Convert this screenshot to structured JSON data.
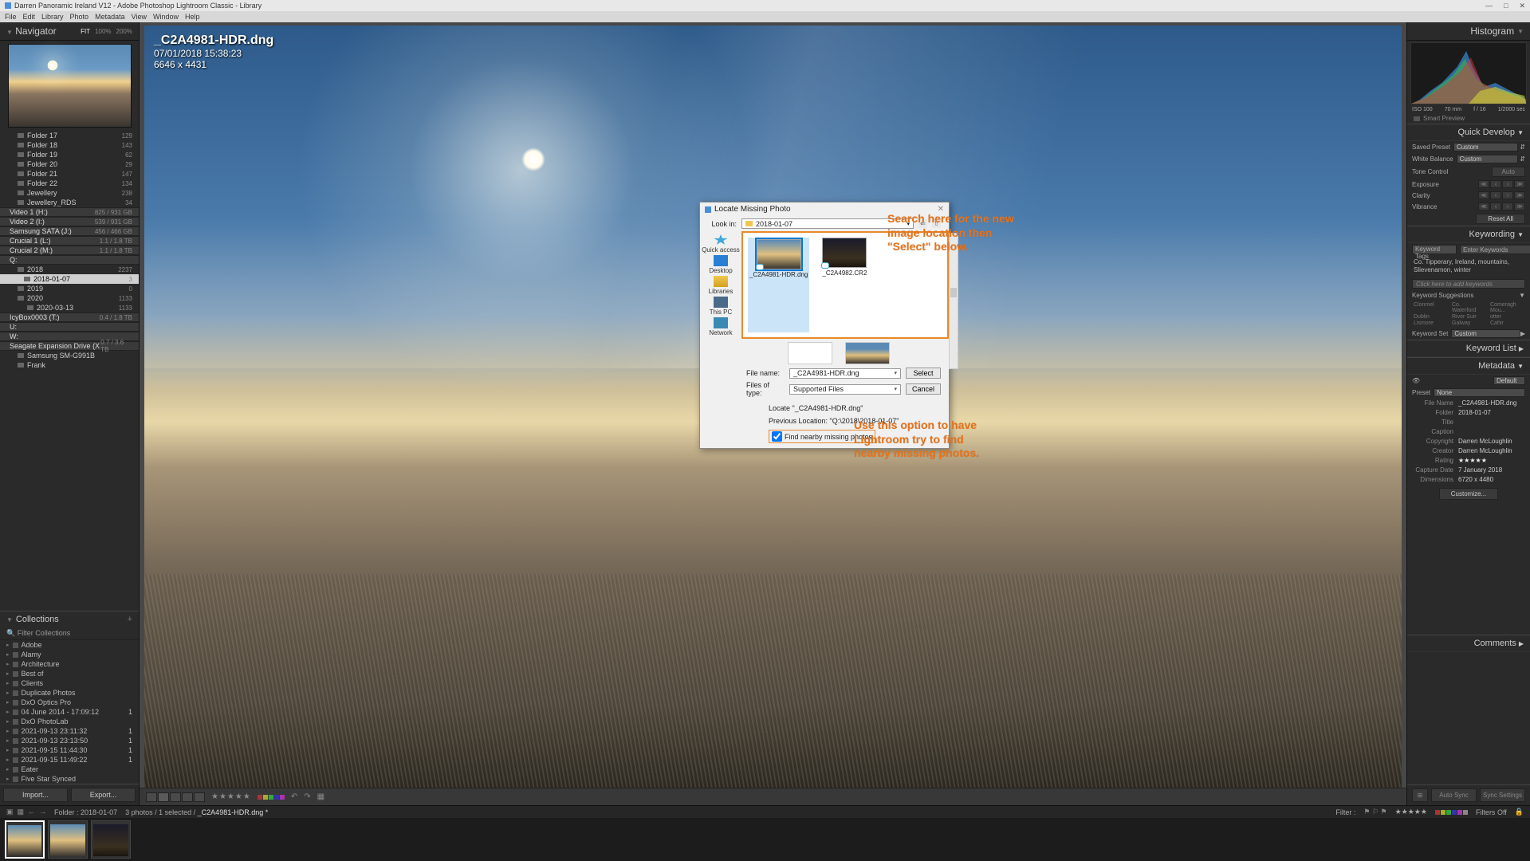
{
  "window": {
    "title": "Darren Panoramic Ireland V12 - Adobe Photoshop Lightroom Classic - Library"
  },
  "menu": [
    "File",
    "Edit",
    "Library",
    "Photo",
    "Metadata",
    "View",
    "Window",
    "Help"
  ],
  "navigator": {
    "title": "Navigator",
    "fit": "FIT",
    "z100": "100%",
    "z200": "200%"
  },
  "folders": [
    {
      "name": "Folder 17",
      "count": "129",
      "type": "sub"
    },
    {
      "name": "Folder 18",
      "count": "143",
      "type": "sub"
    },
    {
      "name": "Folder 19",
      "count": "62",
      "type": "sub"
    },
    {
      "name": "Folder 20",
      "count": "29",
      "type": "sub"
    },
    {
      "name": "Folder 21",
      "count": "147",
      "type": "sub"
    },
    {
      "name": "Folder 22",
      "count": "134",
      "type": "sub"
    },
    {
      "name": "Jewellery",
      "count": "238",
      "type": "sub"
    },
    {
      "name": "Jewellery_RDS",
      "count": "34",
      "type": "sub"
    },
    {
      "name": "Video 1 (H:)",
      "count": "825 / 931 GB",
      "type": "drive"
    },
    {
      "name": "Video 2 (I:)",
      "count": "539 / 931 GB",
      "type": "drive"
    },
    {
      "name": "Samsung SATA (J:)",
      "count": "456 / 466 GB",
      "type": "drive"
    },
    {
      "name": "Crucial 1 (L:)",
      "count": "1.1 / 1.8 TB",
      "type": "drive"
    },
    {
      "name": "Crucial 2 (M:)",
      "count": "1.1 / 1.8 TB",
      "type": "drive"
    },
    {
      "name": "Q:",
      "count": "",
      "type": "drive"
    },
    {
      "name": "2018",
      "count": "2237",
      "type": "sub"
    },
    {
      "name": "2018-01-07",
      "count": "3",
      "type": "selected"
    },
    {
      "name": "2019",
      "count": "0",
      "type": "sub"
    },
    {
      "name": "2020",
      "count": "1133",
      "type": "sub"
    },
    {
      "name": "2020-03-13",
      "count": "1133",
      "type": "subsub"
    },
    {
      "name": "IcyBox0003 (T:)",
      "count": "0.4 / 1.8 TB",
      "type": "drive"
    },
    {
      "name": "U:",
      "count": "",
      "type": "drive"
    },
    {
      "name": "W:",
      "count": "",
      "type": "drive"
    },
    {
      "name": "Seagate Expansion Drive (X:)",
      "count": "0.7 / 3.6 TB",
      "type": "drive"
    },
    {
      "name": "Samsung SM-G991B",
      "count": "",
      "type": "sub"
    },
    {
      "name": "Frank",
      "count": "",
      "type": "sub"
    }
  ],
  "collections_title": "Collections",
  "filter_collections": "Filter Collections",
  "collections": [
    {
      "name": "Adobe",
      "count": ""
    },
    {
      "name": "Alamy",
      "count": ""
    },
    {
      "name": "Architecture",
      "count": ""
    },
    {
      "name": "Best of",
      "count": ""
    },
    {
      "name": "Clients",
      "count": ""
    },
    {
      "name": "Duplicate Photos",
      "count": ""
    },
    {
      "name": "DxO Optics Pro",
      "count": ""
    },
    {
      "name": "04 June 2014 - 17:09:12",
      "count": "1"
    },
    {
      "name": "DxO PhotoLab",
      "count": ""
    },
    {
      "name": "2021-09-13 23:11:32",
      "count": "1"
    },
    {
      "name": "2021-09-13 23:13:50",
      "count": "1"
    },
    {
      "name": "2021-09-15 11:44:30",
      "count": "1"
    },
    {
      "name": "2021-09-15 11:49:22",
      "count": "1"
    },
    {
      "name": "Eater",
      "count": ""
    },
    {
      "name": "Five Star Synced",
      "count": ""
    }
  ],
  "import": "Import...",
  "export": "Export...",
  "overlay": {
    "filename": "_C2A4981-HDR.dng",
    "datetime": "07/01/2018 15:38:23",
    "dims": "6646 x 4431"
  },
  "dialog": {
    "title": "Locate Missing Photo",
    "lookin_label": "Look in:",
    "lookin_value": "2018-01-07",
    "places": [
      "Quick access",
      "Desktop",
      "Libraries",
      "This PC",
      "Network"
    ],
    "files": [
      {
        "name": "_C2A4981-HDR.dng",
        "sel": true
      },
      {
        "name": "_C2A4982.CR2",
        "sel": false
      }
    ],
    "filename_label": "File name:",
    "filename_value": "_C2A4981-HDR.dng",
    "filetype_label": "Files of type:",
    "filetype_value": "Supported Files",
    "select": "Select",
    "cancel": "Cancel",
    "locate": "Locate \"_C2A4981-HDR.dng\"",
    "prev_location": "Previous Location: \"Q:\\2018\\2018-01-07\"",
    "checkbox": "Find nearby missing photos"
  },
  "annotations": {
    "a1": "Search here for the new image location then \"Select\" below.",
    "a2": "Use this option to have Lightroom try to find nearby missing photos."
  },
  "right": {
    "histogram": "Histogram",
    "histo_meta": {
      "iso": "ISO 100",
      "focal": "70 mm",
      "aperture": "f / 16",
      "shutter": "1/2000 sec"
    },
    "smart_preview": "Smart Preview",
    "quick_develop": "Quick Develop",
    "saved_preset_lbl": "Saved Preset",
    "saved_preset": "Custom",
    "wb_lbl": "White Balance",
    "wb": "Custom",
    "tone_control": "Tone Control",
    "auto": "Auto",
    "exposure": "Exposure",
    "clarity": "Clarity",
    "vibrance": "Vibrance",
    "reset_all": "Reset All",
    "keywording": "Keywording",
    "keyword_tags_lbl": "Keyword Tags",
    "keyword_tags": "Enter Keywords",
    "keywords_text": "Co. Tipperary, Ireland, mountains, Slievenamon, winter",
    "kw_entry_ph": "Click here to add keywords",
    "keyword_suggestions": "Keyword Suggestions",
    "suggestions": [
      "Clonmel",
      "Co. Waterford",
      "Comeragh Mou...",
      "Dublin",
      "River Suir",
      "otter",
      "Lismore",
      "Galway",
      "Cahir"
    ],
    "keyword_set_lbl": "Keyword Set",
    "keyword_set": "Custom",
    "keyword_list": "Keyword List",
    "metadata": "Metadata",
    "preset_lbl": "Preset",
    "preset": "None",
    "default_lbl": "Default",
    "meta": [
      {
        "l": "File Name",
        "v": "_C2A4981-HDR.dng"
      },
      {
        "l": "Folder",
        "v": "2018-01-07"
      },
      {
        "l": "Title",
        "v": ""
      },
      {
        "l": "Caption",
        "v": ""
      },
      {
        "l": "Copyright",
        "v": "Darren McLoughlin"
      },
      {
        "l": "Creator",
        "v": "Darren McLoughlin"
      },
      {
        "l": "Rating",
        "v": "★★★★★"
      },
      {
        "l": "Capture Date",
        "v": "7 January 2018"
      },
      {
        "l": "Dimensions",
        "v": "6720 x 4480"
      }
    ],
    "customize": "Customize...",
    "comments": "Comments",
    "auto_sync": "Auto Sync",
    "sync_settings": "Sync Settings"
  },
  "statusbar": {
    "folder": "Folder : 2018-01-07",
    "count": "3 photos / 1 selected /",
    "file": "_C2A4981-HDR.dng *",
    "filter_lbl": "Filter :",
    "filters_off": "Filters Off"
  }
}
